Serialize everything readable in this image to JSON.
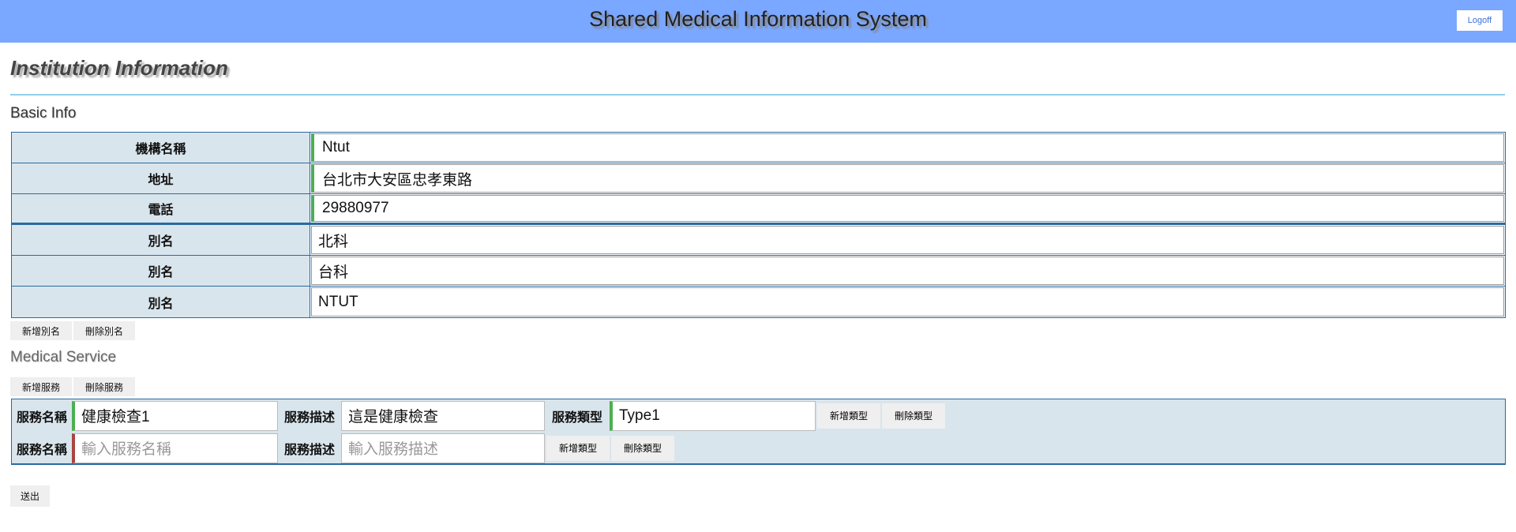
{
  "header": {
    "title": "Shared Medical Information System",
    "logoff": "Logoff"
  },
  "page": {
    "title": "Institution Information"
  },
  "basic": {
    "heading": "Basic Info",
    "rows": [
      {
        "label": "機構名稱",
        "value": "Ntut"
      },
      {
        "label": "地址",
        "value": "台北市大安區忠孝東路"
      },
      {
        "label": "電話",
        "value": "29880977"
      },
      {
        "label": "別名",
        "value": "北科"
      },
      {
        "label": "別名",
        "value": "台科"
      },
      {
        "label": "別名",
        "value": "NTUT"
      }
    ],
    "add_alias": "新增別名",
    "delete_alias": "刪除別名"
  },
  "medical": {
    "heading": "Medical Service",
    "add_service": "新增服務",
    "delete_service": "刪除服務",
    "name_label": "服務名稱",
    "desc_label": "服務描述",
    "type_label": "服務類型",
    "add_type": "新增類型",
    "delete_type": "刪除類型",
    "services": [
      {
        "name": "健康檢查1",
        "desc": "這是健康檢查",
        "type": "Type1"
      },
      {
        "name_placeholder": "輸入服務名稱",
        "desc_placeholder": "輸入服務描述"
      }
    ]
  },
  "submit": "送出"
}
